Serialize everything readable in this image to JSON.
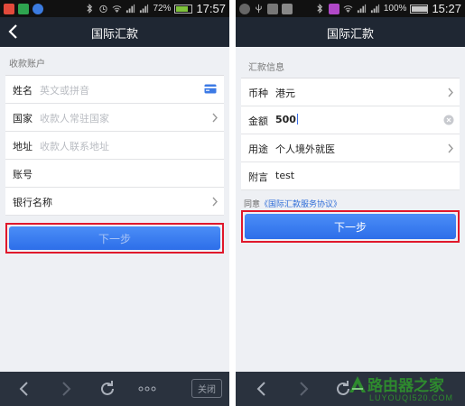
{
  "left": {
    "status": {
      "battery": "72%",
      "time": "17:57"
    },
    "nav": {
      "title": "国际汇款"
    },
    "section": "收款账户",
    "fields": [
      {
        "label": "姓名",
        "placeholder": "英文或拼音"
      },
      {
        "label": "国家",
        "placeholder": "收款人常驻国家"
      },
      {
        "label": "地址",
        "placeholder": "收款人联系地址"
      },
      {
        "label": "账号",
        "placeholder": ""
      },
      {
        "label": "银行名称",
        "placeholder": ""
      }
    ],
    "next_button": "下一步",
    "bottom": {
      "close": "关闭"
    }
  },
  "right": {
    "status": {
      "battery": "100%",
      "time": "15:27"
    },
    "nav": {
      "title": "国际汇款"
    },
    "section": "汇款信息",
    "fields": [
      {
        "label": "币种",
        "value": "港元"
      },
      {
        "label": "金额",
        "value": "500"
      },
      {
        "label": "用途",
        "value": "个人境外就医"
      },
      {
        "label": "附言",
        "value": "test"
      }
    ],
    "agree_prefix": "同意",
    "agree_link": "《国际汇款服务协议》",
    "next_button": "下一步"
  },
  "watermark": {
    "text": "路由器之家",
    "url": "LUYOUQI520.COM"
  },
  "colors": {
    "navbar": "#1f2733",
    "button": "#3a7df0",
    "highlight": "#e0182b",
    "bottombar": "#2a323e"
  }
}
